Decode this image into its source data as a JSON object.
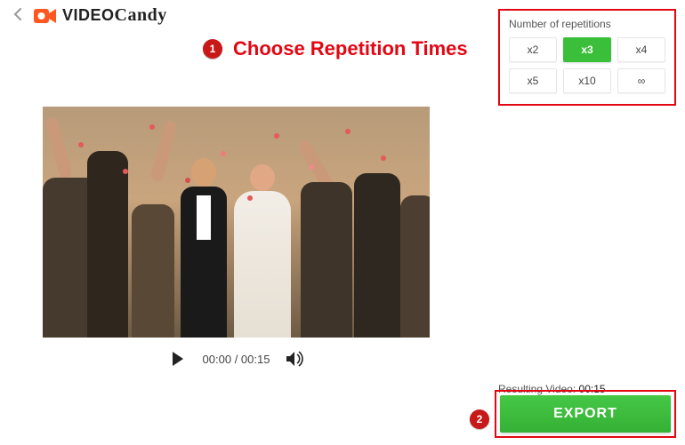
{
  "brand": {
    "text_bold": "VIDEO",
    "text_script": "Candy"
  },
  "annotations": {
    "one": {
      "num": "1",
      "label": "Choose Repetition Times"
    },
    "two": {
      "num": "2"
    }
  },
  "player": {
    "time_current": "00:00",
    "time_sep": " / ",
    "time_total": "00:15"
  },
  "repetition": {
    "title": "Number of repetitions",
    "options": [
      "x2",
      "x3",
      "x4",
      "x5",
      "x10",
      "∞"
    ],
    "selected_index": 1
  },
  "result": {
    "label": "Resulting Video: ",
    "value": "00:15"
  },
  "export_label": "EXPORT"
}
